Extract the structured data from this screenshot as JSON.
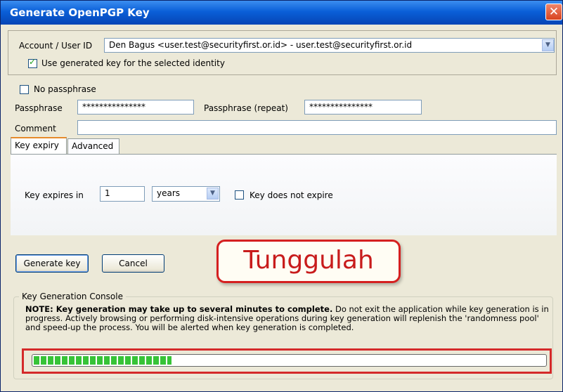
{
  "window": {
    "title": "Generate OpenPGP Key",
    "close_glyph": "✕"
  },
  "account": {
    "label": "Account / User ID",
    "value": "Den Bagus <user.test@securityfirst.or.id> - user.test@securityfirst.or.id",
    "use_generated_label": "Use generated key for the selected identity",
    "use_generated_checked": true
  },
  "passphrase": {
    "no_passphrase_label": "No passphrase",
    "no_passphrase_checked": false,
    "label": "Passphrase",
    "value": "***************",
    "repeat_label": "Passphrase (repeat)",
    "repeat_value": "***************"
  },
  "comment": {
    "label": "Comment",
    "value": ""
  },
  "tabs": [
    {
      "label": "Key expiry",
      "active": true
    },
    {
      "label": "Advanced",
      "active": false
    }
  ],
  "expiry": {
    "label": "Key expires in",
    "amount": "1",
    "unit": "years",
    "no_expire_label": "Key does not expire",
    "no_expire_checked": false
  },
  "buttons": {
    "generate": "Generate key",
    "cancel": "Cancel"
  },
  "callout": "Tunggulah",
  "console": {
    "title": "Key Generation Console",
    "note_bold": "NOTE: Key generation may take up to several minutes to complete.",
    "note_rest": " Do not exit the application while key generation is in progress. Actively browsing or performing disk-intensive operations during key generation will replenish the 'randomness pool' and speed-up the process. You will be alerted when key generation is completed.",
    "progress_fraction": 0.27
  },
  "colors": {
    "title_bar": "#0a5fd8",
    "progress": "#37c337",
    "highlight": "#d42a2a"
  },
  "icons": {
    "dropdown": "chevron-down-icon",
    "check": "checkmark-icon",
    "close": "close-icon"
  }
}
